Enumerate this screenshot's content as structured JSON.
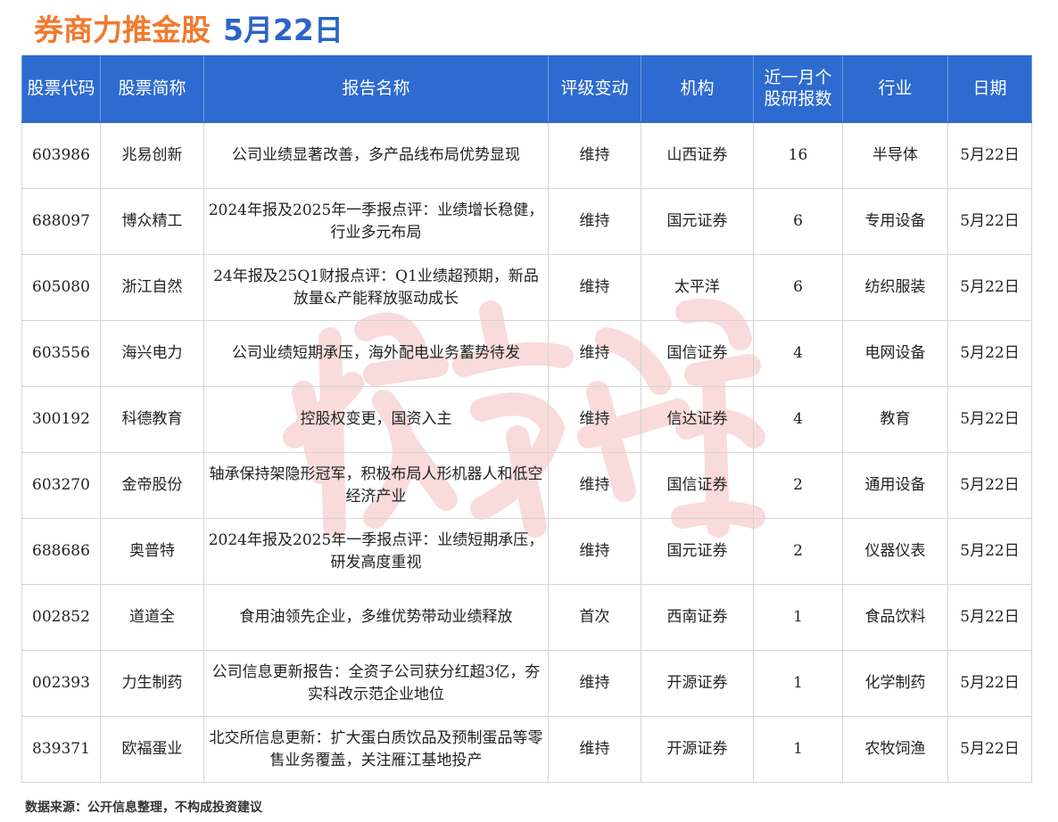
{
  "title": {
    "main": "券商力推金股",
    "date": "5月22日"
  },
  "table": {
    "headers": [
      "股票代码",
      "股票简称",
      "报告名称",
      "评级变动",
      "机构",
      "近一月个股研报数",
      "行业",
      "日期"
    ],
    "rows": [
      {
        "code": "603986",
        "name": "兆易创新",
        "report": "公司业绩显著改善，多产品线布局优势显现",
        "rating": "维持",
        "org": "山西证券",
        "count": "16",
        "industry": "半导体",
        "date": "5月22日"
      },
      {
        "code": "688097",
        "name": "博众精工",
        "report": "2024年报及2025年一季报点评：业绩增长稳健，行业多元布局",
        "rating": "维持",
        "org": "国元证券",
        "count": "6",
        "industry": "专用设备",
        "date": "5月22日"
      },
      {
        "code": "605080",
        "name": "浙江自然",
        "report": "24年报及25Q1财报点评：Q1业绩超预期，新品放量&产能释放驱动成长",
        "rating": "维持",
        "org": "太平洋",
        "count": "6",
        "industry": "纺织服装",
        "date": "5月22日"
      },
      {
        "code": "603556",
        "name": "海兴电力",
        "report": "公司业绩短期承压，海外配电业务蓄势待发",
        "rating": "维持",
        "org": "国信证券",
        "count": "4",
        "industry": "电网设备",
        "date": "5月22日"
      },
      {
        "code": "300192",
        "name": "科德教育",
        "report": "控股权变更，国资入主",
        "rating": "维持",
        "org": "信达证券",
        "count": "4",
        "industry": "教育",
        "date": "5月22日"
      },
      {
        "code": "603270",
        "name": "金帝股份",
        "report": "轴承保持架隐形冠军，积极布局人形机器人和低空经济产业",
        "rating": "维持",
        "org": "国信证券",
        "count": "2",
        "industry": "通用设备",
        "date": "5月22日"
      },
      {
        "code": "688686",
        "name": "奥普特",
        "report": "2024年报及2025年一季报点评：业绩短期承压，研发高度重视",
        "rating": "维持",
        "org": "国元证券",
        "count": "2",
        "industry": "仪器仪表",
        "date": "5月22日"
      },
      {
        "code": "002852",
        "name": "道道全",
        "report": "食用油领先企业，多维优势带动业绩释放",
        "rating": "首次",
        "org": "西南证券",
        "count": "1",
        "industry": "食品饮料",
        "date": "5月22日"
      },
      {
        "code": "002393",
        "name": "力生制药",
        "report": "公司信息更新报告：全资子公司获分红超3亿，夯实科改示范企业地位",
        "rating": "维持",
        "org": "开源证券",
        "count": "1",
        "industry": "化学制药",
        "date": "5月22日"
      },
      {
        "code": "839371",
        "name": "欧福蛋业",
        "report": "北交所信息更新：扩大蛋白质饮品及预制蛋品等零售业务覆盖，关注雁江基地投产",
        "rating": "维持",
        "org": "开源证券",
        "count": "1",
        "industry": "农牧饲渔",
        "date": "5月22日"
      }
    ]
  },
  "footer": {
    "source": "数据来源：公开信息整理，不构成投资建议"
  },
  "colors": {
    "header_bg": "#2d6bd0",
    "title_orange": "#f07a2e",
    "title_blue": "#2c64c8",
    "watermark": "#e04040"
  },
  "icons": {
    "watermark": "calligraphy-watermark"
  }
}
